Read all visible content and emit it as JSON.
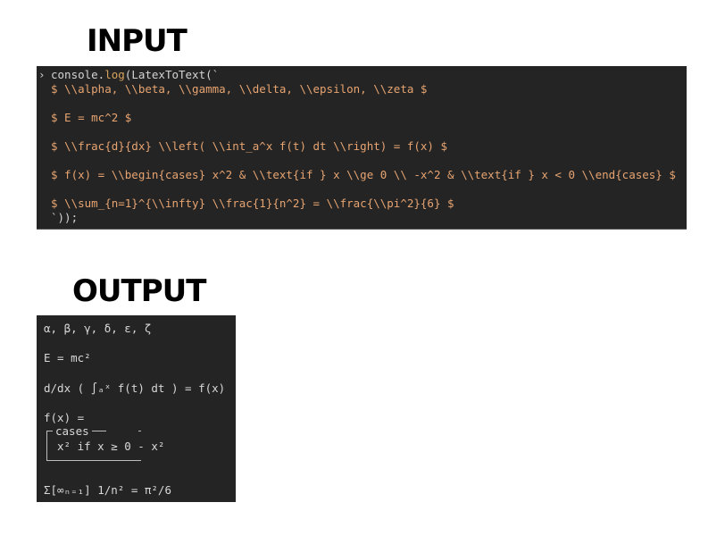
{
  "headings": {
    "input": "INPUT",
    "output": "OUTPUT"
  },
  "input_console": {
    "prompt_symbol": "›",
    "call_prefix": "console.",
    "call_method": "log",
    "call_open": "(LatexToText(`",
    "lines": [
      "$ \\\\alpha, \\\\beta, \\\\gamma, \\\\delta, \\\\epsilon, \\\\zeta $",
      "$ E = mc^2 $",
      "$ \\\\frac{d}{dx} \\\\left( \\\\int_a^x f(t) dt \\\\right) = f(x) $",
      "$ f(x) = \\\\begin{cases} x^2 & \\\\text{if } x \\\\ge 0 \\\\ -x^2 & \\\\text{if } x < 0 \\\\end{cases} $",
      "$ \\\\sum_{n=1}^{\\\\infty} \\\\frac{1}{n^2} = \\\\frac{\\\\pi^2}{6} $"
    ],
    "call_close": "`));"
  },
  "output_console": {
    "greek": "α, β, γ, δ, ε, ζ",
    "energy": "E = mc²",
    "derivative": "d/dx ( ∫ₐˣ f(t) dt ) = f(x)",
    "piecewise_head": "f(x) =",
    "cases_label": "cases",
    "cases_body": "x² if x ≥ 0 - x²",
    "series": "Σ[∞ₙ₌₁] 1/n² = π²/6"
  },
  "colors": {
    "console_bg": "#242424",
    "string_orange": "#e7a471",
    "text_light": "#d4d4d4"
  }
}
